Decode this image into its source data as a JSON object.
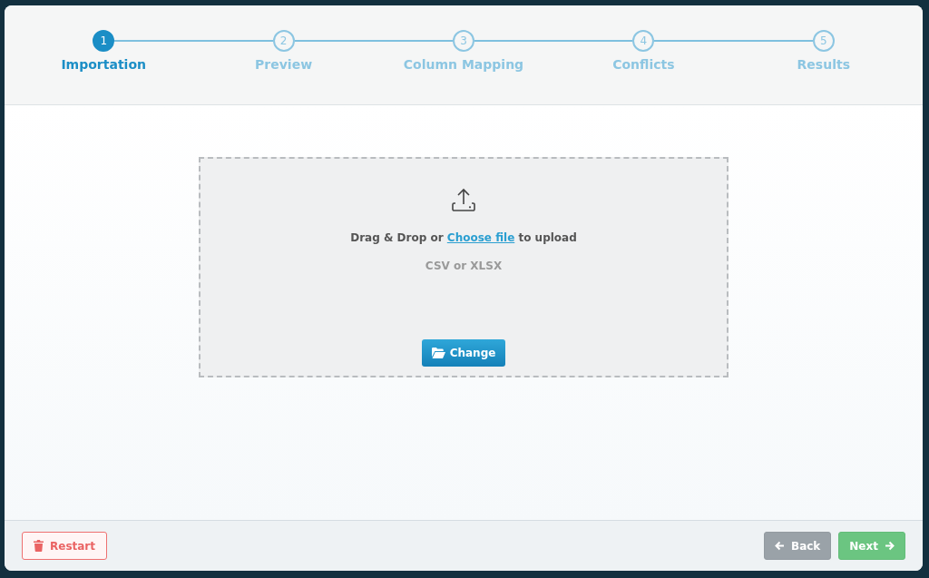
{
  "steps": [
    {
      "number": "1",
      "label": "Importation",
      "selected": true
    },
    {
      "number": "2",
      "label": "Preview",
      "selected": false
    },
    {
      "number": "3",
      "label": "Column Mapping",
      "selected": false
    },
    {
      "number": "4",
      "label": "Conflicts",
      "selected": false
    },
    {
      "number": "5",
      "label": "Results",
      "selected": false
    }
  ],
  "dropzone": {
    "prompt_before": "Drag & Drop or",
    "link": "Choose file",
    "prompt_after": "to upload",
    "formats": "CSV or XLSX",
    "button": "Change"
  },
  "footer": {
    "buttons": [
      {
        "label": "Restart",
        "kind": "danger-outline"
      },
      {
        "label": "Back",
        "kind": "secondary"
      },
      {
        "label": "Next",
        "kind": "success"
      }
    ]
  }
}
